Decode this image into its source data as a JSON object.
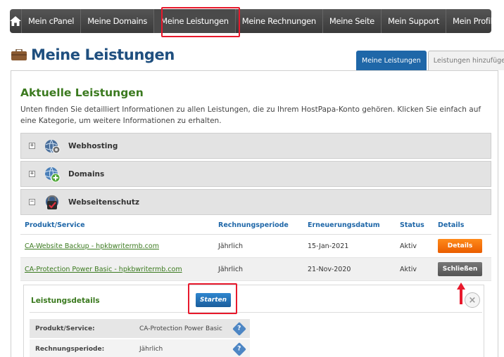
{
  "nav": {
    "home_icon": "home-icon",
    "items": [
      {
        "label": "Mein cPanel"
      },
      {
        "label": "Meine Domains"
      },
      {
        "label": "Meine Leistungen"
      },
      {
        "label": "Meine Rechnungen"
      },
      {
        "label": "Meine Seite"
      },
      {
        "label": "Mein Support"
      },
      {
        "label": "Mein Profil"
      }
    ],
    "active": "Meine Leistungen"
  },
  "page": {
    "title": "Meine Leistungen",
    "title_icon": "briefcase-icon",
    "tabs": [
      {
        "label": "Meine Leistungen",
        "active": true
      },
      {
        "label": "Leistungen hinzufügen",
        "active": false
      }
    ]
  },
  "section": {
    "title": "Aktuelle Leistungen",
    "intro": "Unten finden Sie detailliert Informationen zu allen Leistungen, die zu Ihrem HostPapa-Konto gehören. Klicken Sie einfach auf eine Kategorie, um weitere Informationen zu erhalten."
  },
  "categories": [
    {
      "label": "Webhosting",
      "toggle": "+",
      "icon": "globe-gear-icon"
    },
    {
      "label": "Domains",
      "toggle": "+",
      "icon": "globe-plus-icon"
    },
    {
      "label": "Webseitenschutz",
      "toggle": "−",
      "icon": "shield-lock-icon"
    }
  ],
  "table": {
    "headers": [
      "Produkt/Service",
      "Rechnungsperiode",
      "Erneuerungsdatum",
      "Status",
      "Details"
    ],
    "rows": [
      {
        "product": "CA-Website Backup - hpkbwritermb.com",
        "period": "Jährlich",
        "renewal": "15-Jan-2021",
        "status": "Aktiv",
        "action": "Details"
      },
      {
        "product": "CA-Protection Power Basic - hpkbwritermb.com",
        "period": "Jährlich",
        "renewal": "21-Nov-2020",
        "status": "Aktiv",
        "action": "Schließen"
      }
    ]
  },
  "details_panel": {
    "title": "Leistungsdetails",
    "start_label": "Starten",
    "close_symbol": "×",
    "rows": [
      {
        "label": "Produkt/Service:",
        "value": "CA-Protection Power Basic",
        "help": "?"
      },
      {
        "label": "Rechnungsperiode:",
        "value": "Jährlich",
        "help": "?"
      }
    ]
  },
  "colors": {
    "nav_bg": "#3a3a3a",
    "title_blue": "#1f4f7f",
    "section_green": "#3b7a1f",
    "link_green": "#3b7a1f",
    "details_orange": "#ea5d00",
    "close_gray": "#555555",
    "start_blue": "#1a5e9c",
    "highlight_red": "#e8192c"
  }
}
